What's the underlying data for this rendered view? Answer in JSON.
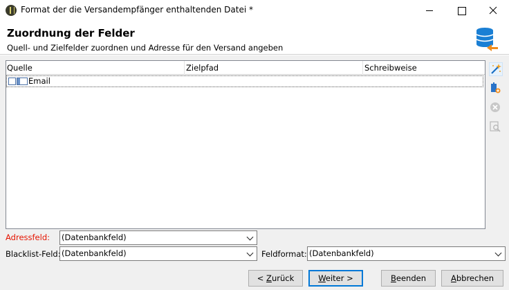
{
  "window": {
    "title": "Format der die Versandempfänger enthaltenden Datei *"
  },
  "header": {
    "title": "Zuordnung der Felder",
    "subtitle": "Quell- und Zielfelder zuordnen und Adresse für den Versand angeben",
    "icon": "database-icon"
  },
  "grid": {
    "columns": [
      "Quelle",
      "Zielpfad",
      "Schreibweise"
    ],
    "rows": [
      {
        "source": "Email",
        "target": "",
        "case": ""
      }
    ]
  },
  "side_toolbar": [
    "magic-wand-icon",
    "add-mapping-icon",
    "delete-icon",
    "preview-icon"
  ],
  "form": {
    "address_field": {
      "label": "Adressfeld:",
      "value": "(Datenbankfeld)"
    },
    "blacklist_field": {
      "label": "Blacklist-Feld:",
      "value": "(Datenbankfeld)"
    },
    "field_format": {
      "label": "Feldformat:",
      "value": "(Datenbankfeld)"
    }
  },
  "buttons": {
    "back": {
      "accel": "Z",
      "rest": "urück",
      "prefix": "< "
    },
    "next": {
      "accel": "W",
      "rest": "eiter",
      "suffix": " >"
    },
    "finish": {
      "accel": "B",
      "rest": "eenden"
    },
    "cancel": {
      "accel": "A",
      "rest": "bbrechen"
    }
  },
  "colors": {
    "accent": "#0078d7",
    "required_label": "#e51400",
    "db_icon_blue": "#1a7fd4",
    "db_icon_orange": "#f08c1c"
  }
}
